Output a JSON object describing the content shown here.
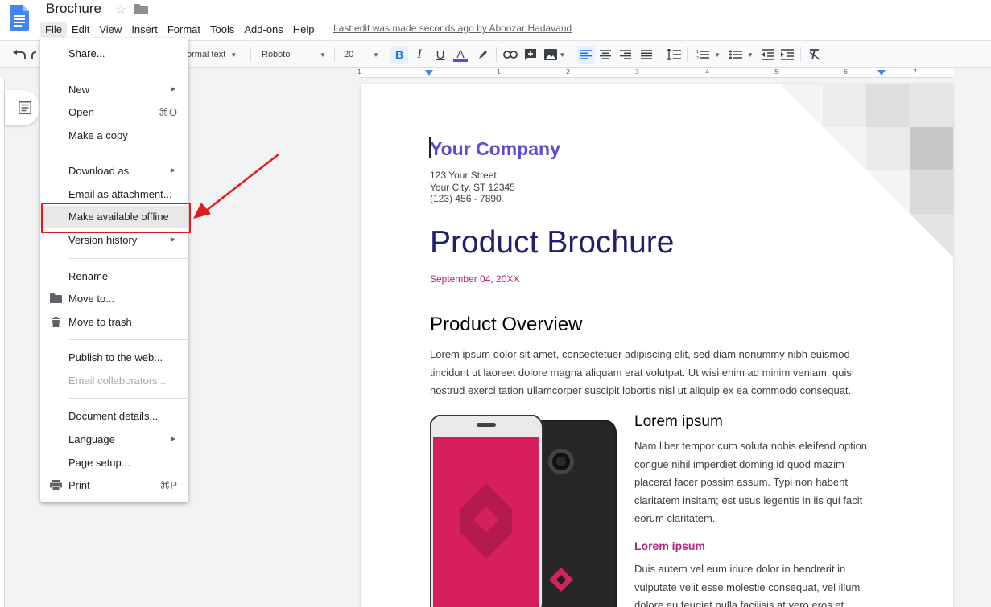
{
  "header": {
    "title": "Brochure",
    "menu": [
      "File",
      "Edit",
      "View",
      "Insert",
      "Format",
      "Tools",
      "Add-ons",
      "Help"
    ],
    "last_edit": "Last edit was made seconds ago by Aboozar Hadavand"
  },
  "toolbar": {
    "style": "ormal text",
    "font": "Roboto",
    "size": "20"
  },
  "ruler": {
    "ticks": [
      "1",
      "1",
      "2",
      "3",
      "4",
      "5",
      "6",
      "7"
    ]
  },
  "file_menu": {
    "share": "Share...",
    "new": "New",
    "open": "Open",
    "open_shortcut": "⌘O",
    "make_copy": "Make a copy",
    "download_as": "Download as",
    "email_attachment": "Email as attachment...",
    "make_offline": "Make available offline",
    "version_history": "Version history",
    "rename": "Rename",
    "move_to": "Move to...",
    "move_trash": "Move to trash",
    "publish": "Publish to the web...",
    "email_collab": "Email collaborators...",
    "doc_details": "Document details...",
    "language": "Language",
    "page_setup": "Page setup...",
    "print": "Print",
    "print_shortcut": "⌘P"
  },
  "document": {
    "company": "Your Company",
    "street": "123 Your Street",
    "city": "Your City, ST 12345",
    "phone": "(123) 456 - 7890",
    "title": "Product Brochure",
    "date": "September 04, 20XX",
    "overview_heading": "Product Overview",
    "overview_text": "Lorem ipsum dolor sit amet, consectetuer adipiscing elit, sed diam nonummy nibh euismod tincidunt ut laoreet dolore magna aliquam erat volutpat. Ut wisi enim ad minim veniam, quis nostrud exerci tation ullamcorper suscipit lobortis nisl ut aliquip ex ea commodo consequat.",
    "sub_heading": "Lorem ipsum",
    "sub_text": "Nam liber tempor cum soluta nobis eleifend option congue nihil imperdiet doming id quod mazim placerat facer possim assum. Typi non habent claritatem insitam; est usus legentis in iis qui facit eorum claritatem.",
    "sub_heading2": "Lorem ipsum",
    "sub_text2": "Duis autem vel eum iriure dolor in hendrerit in vulputate velit esse molestie consequat, vel illum dolore eu feugiat nulla facilisis at vero eros et"
  },
  "colors": {
    "accent_blue": "#1a73e8",
    "company": "#5b4bd1",
    "title": "#1f1f6e",
    "magenta": "#b0237d",
    "annotation_red": "#e11b1b"
  }
}
